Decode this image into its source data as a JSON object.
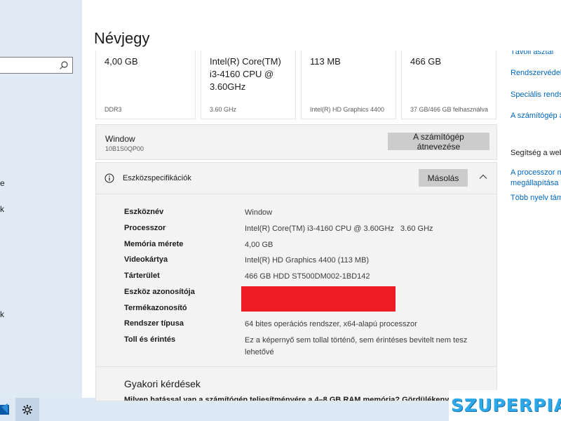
{
  "page": {
    "title": "Névjegy"
  },
  "sidebar": {
    "search_placeholder": "",
    "fragments": [
      "e",
      "k",
      "k"
    ]
  },
  "spec_cards": [
    {
      "value": "4,00 GB",
      "sub": "DDR3"
    },
    {
      "value": "Intel(R) Core(TM) i3-4160 CPU @ 3.60GHz",
      "sub": "3.60 GHz"
    },
    {
      "value": "113 MB",
      "sub": "Intel(R) HD Graphics 4400"
    },
    {
      "value": "466 GB",
      "sub": "37 GB/466 GB felhasználva"
    }
  ],
  "rename": {
    "device_name": "Window",
    "device_code": "10B1S0QP00",
    "button_label": "A számítógép átnevezése"
  },
  "specs": {
    "title": "Eszközspecifikációk",
    "copy_label": "Másolás",
    "rows": [
      {
        "label": "Eszköznév",
        "value": "Window"
      },
      {
        "label": "Processzor",
        "value": "Intel(R) Core(TM) i3-4160 CPU @ 3.60GHz   3.60 GHz"
      },
      {
        "label": "Memória mérete",
        "value": "4,00 GB"
      },
      {
        "label": "Videokártya",
        "value": "Intel(R) HD Graphics 4400 (113 MB)"
      },
      {
        "label": "Tárterület",
        "value": "466 GB HDD ST500DM002-1BD142"
      },
      {
        "label": "Eszköz azonosítója",
        "value": ""
      },
      {
        "label": "Termékazonosító",
        "value": ""
      },
      {
        "label": "Rendszer típusa",
        "value": "64 bites operációs rendszer, x64-alapú processzor"
      },
      {
        "label": "Toll és érintés",
        "value": "Ez a képernyő sem tollal történő, sem érintéses bevitelt nem tesz lehetővé"
      }
    ]
  },
  "faq": {
    "title": "Gyakori kérdések",
    "question": "Milyen hatással van a számítógép teljesítményére a 4–8 GB RAM memória? Gördülékeny"
  },
  "related": {
    "links_top": [
      "Távoli asztal",
      "Rendszervédelem",
      "Speciális rendszerbeállítások",
      "A számítógép átnevezése"
    ],
    "help_heading": "Segítség a webről",
    "links_help": [
      "A processzor magjainak",
      "megállapítása",
      "Több nyelv támogatása"
    ]
  },
  "watermark": {
    "text": "SZUPERPIAC"
  },
  "colors": {
    "sidebar_bg": "#dfeaf4",
    "panel_bg": "#f3f3f3",
    "button_bg": "#cccccc",
    "link": "#0067c0",
    "redaction": "#ee1c24",
    "watermark": "#2da8e8"
  }
}
